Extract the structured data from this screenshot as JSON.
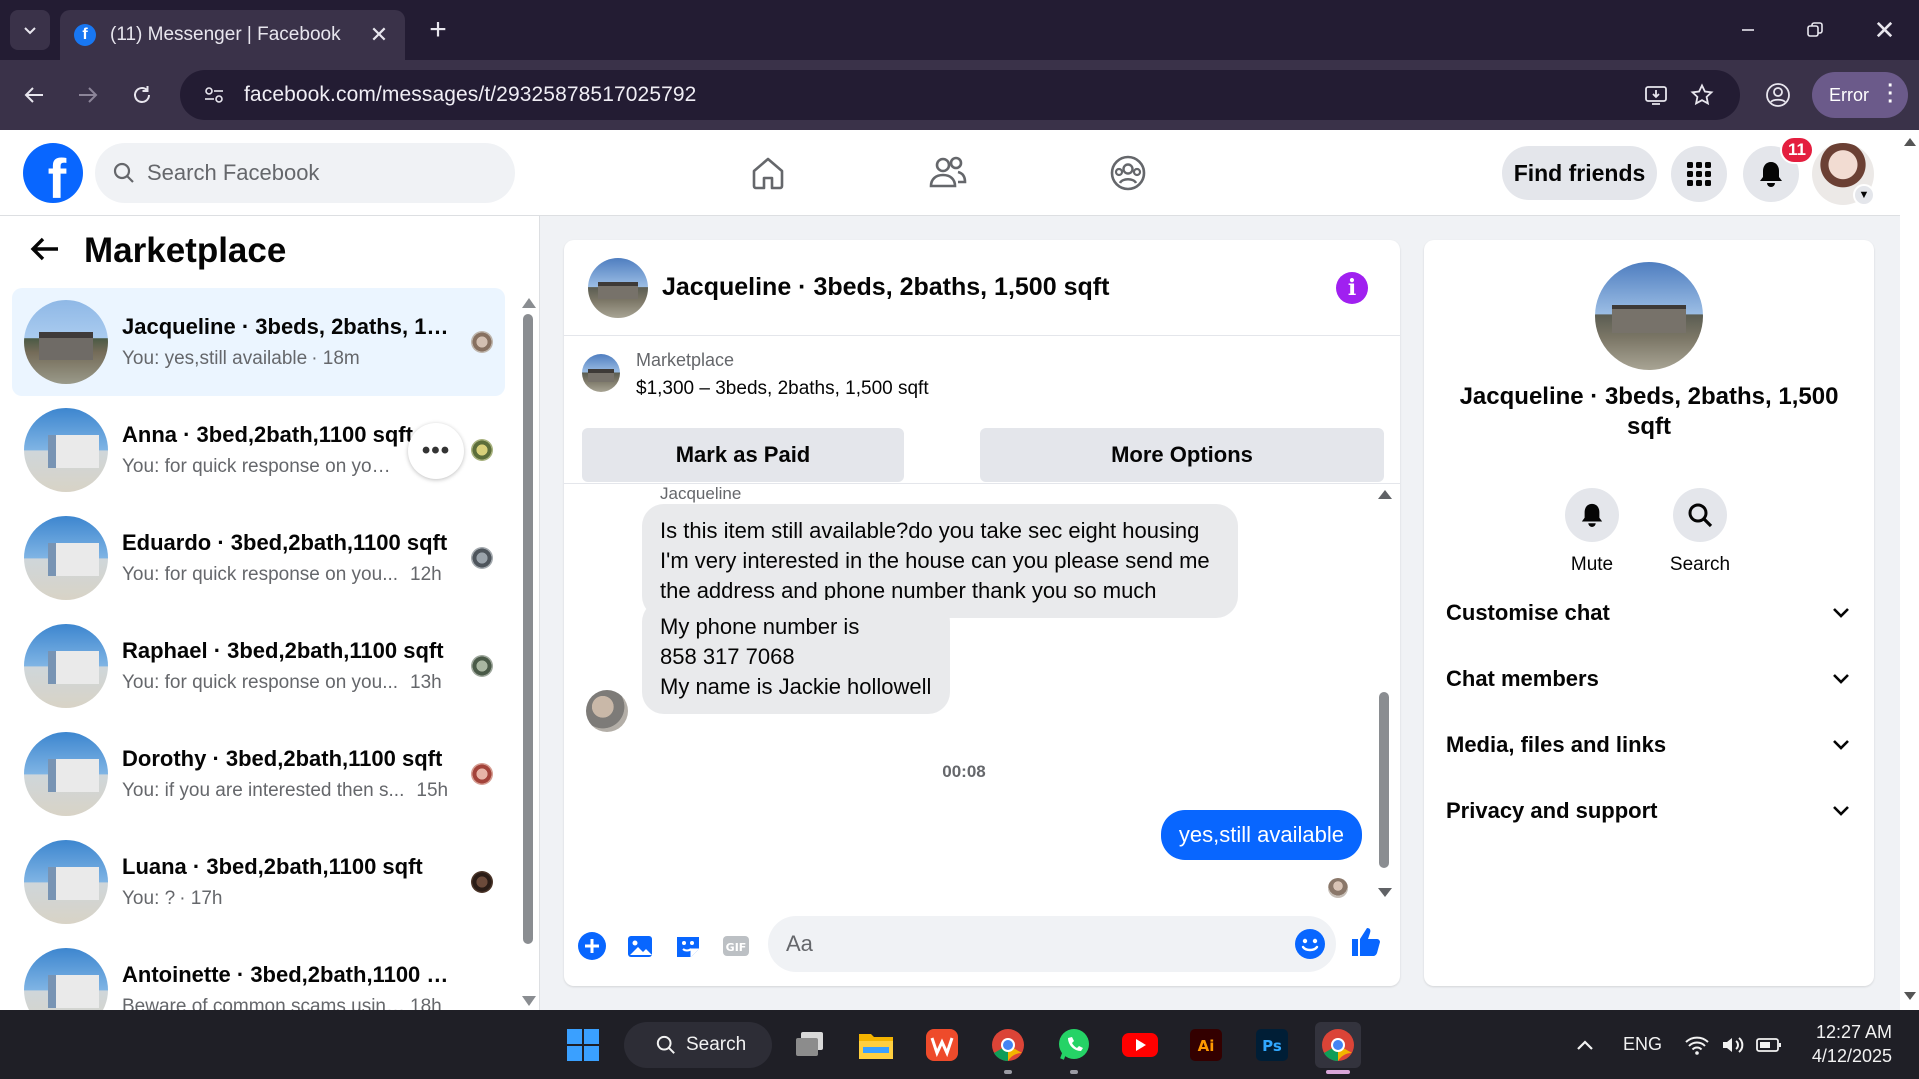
{
  "browser": {
    "tab_title": "(11) Messenger | Facebook",
    "url": "facebook.com/messages/t/29325878517025792",
    "profile_button_label": "Error"
  },
  "fb_nav": {
    "search_placeholder": "Search Facebook",
    "find_friends_label": "Find friends",
    "notification_count": "11",
    "icons": [
      "home-icon",
      "friends-icon",
      "groups-icon",
      "menu-grid-icon",
      "bell-icon"
    ]
  },
  "sidebar": {
    "title": "Marketplace",
    "chats": [
      {
        "name": "Jacqueline · 3beds, 2baths, 1,5...",
        "preview": "You: yes,still available",
        "time": "· 18m",
        "active": true
      },
      {
        "name": "Anna · 3bed,2bath,1100 sqft",
        "preview": "You: for quick response on your ...",
        "time": "",
        "active": false
      },
      {
        "name": "Eduardo · 3bed,2bath,1100 sqft",
        "preview": "You: for quick response on you...",
        "time": "12h",
        "active": false
      },
      {
        "name": "Raphael · 3bed,2bath,1100 sqft",
        "preview": "You: for quick response on you...",
        "time": "13h",
        "active": false
      },
      {
        "name": "Dorothy · 3bed,2bath,1100 sqft",
        "preview": "You: if you are interested then s...",
        "time": "15h",
        "active": false
      },
      {
        "name": "Luana · 3bed,2bath,1100 sqft",
        "preview": "You: ?",
        "time": "· 17h",
        "active": false
      },
      {
        "name": "Antoinette · 3bed,2bath,1100 sqft",
        "preview": "Beware of common scams using p...",
        "time": "18h",
        "active": false
      }
    ]
  },
  "conversation": {
    "title": "Jacqueline · 3beds, 2baths, 1,500 sqft",
    "listing": {
      "source": "Marketplace",
      "price_line": "$1,300 – 3beds, 2baths, 1,500 sqft",
      "mark_paid_label": "Mark as Paid",
      "more_options_label": "More Options"
    },
    "sender_name": "Jacqueline",
    "incoming": [
      "Is this item still available?do you take sec eight housing I'm very interested in the house can you please send me the address and phone number thank you so much",
      [
        "My phone number is",
        "858 317 7068",
        "My name is Jackie hollowell"
      ]
    ],
    "timestamp": "00:08",
    "outgoing": "yes,still available",
    "input_placeholder": "Aa"
  },
  "info_panel": {
    "title": "Jacqueline · 3beds, 2baths, 1,500 sqft",
    "mute_label": "Mute",
    "search_label": "Search",
    "sections": [
      "Customise chat",
      "Chat members",
      "Media, files and links",
      "Privacy and support"
    ]
  },
  "taskbar": {
    "search_label": "Search",
    "language": "ENG",
    "time": "12:27 AM",
    "date": "4/12/2025"
  },
  "colors": {
    "fb_blue": "#0866ff",
    "info_purple": "#a020f0",
    "badge_red": "#e41e3f",
    "chrome_dark": "#231c33"
  }
}
